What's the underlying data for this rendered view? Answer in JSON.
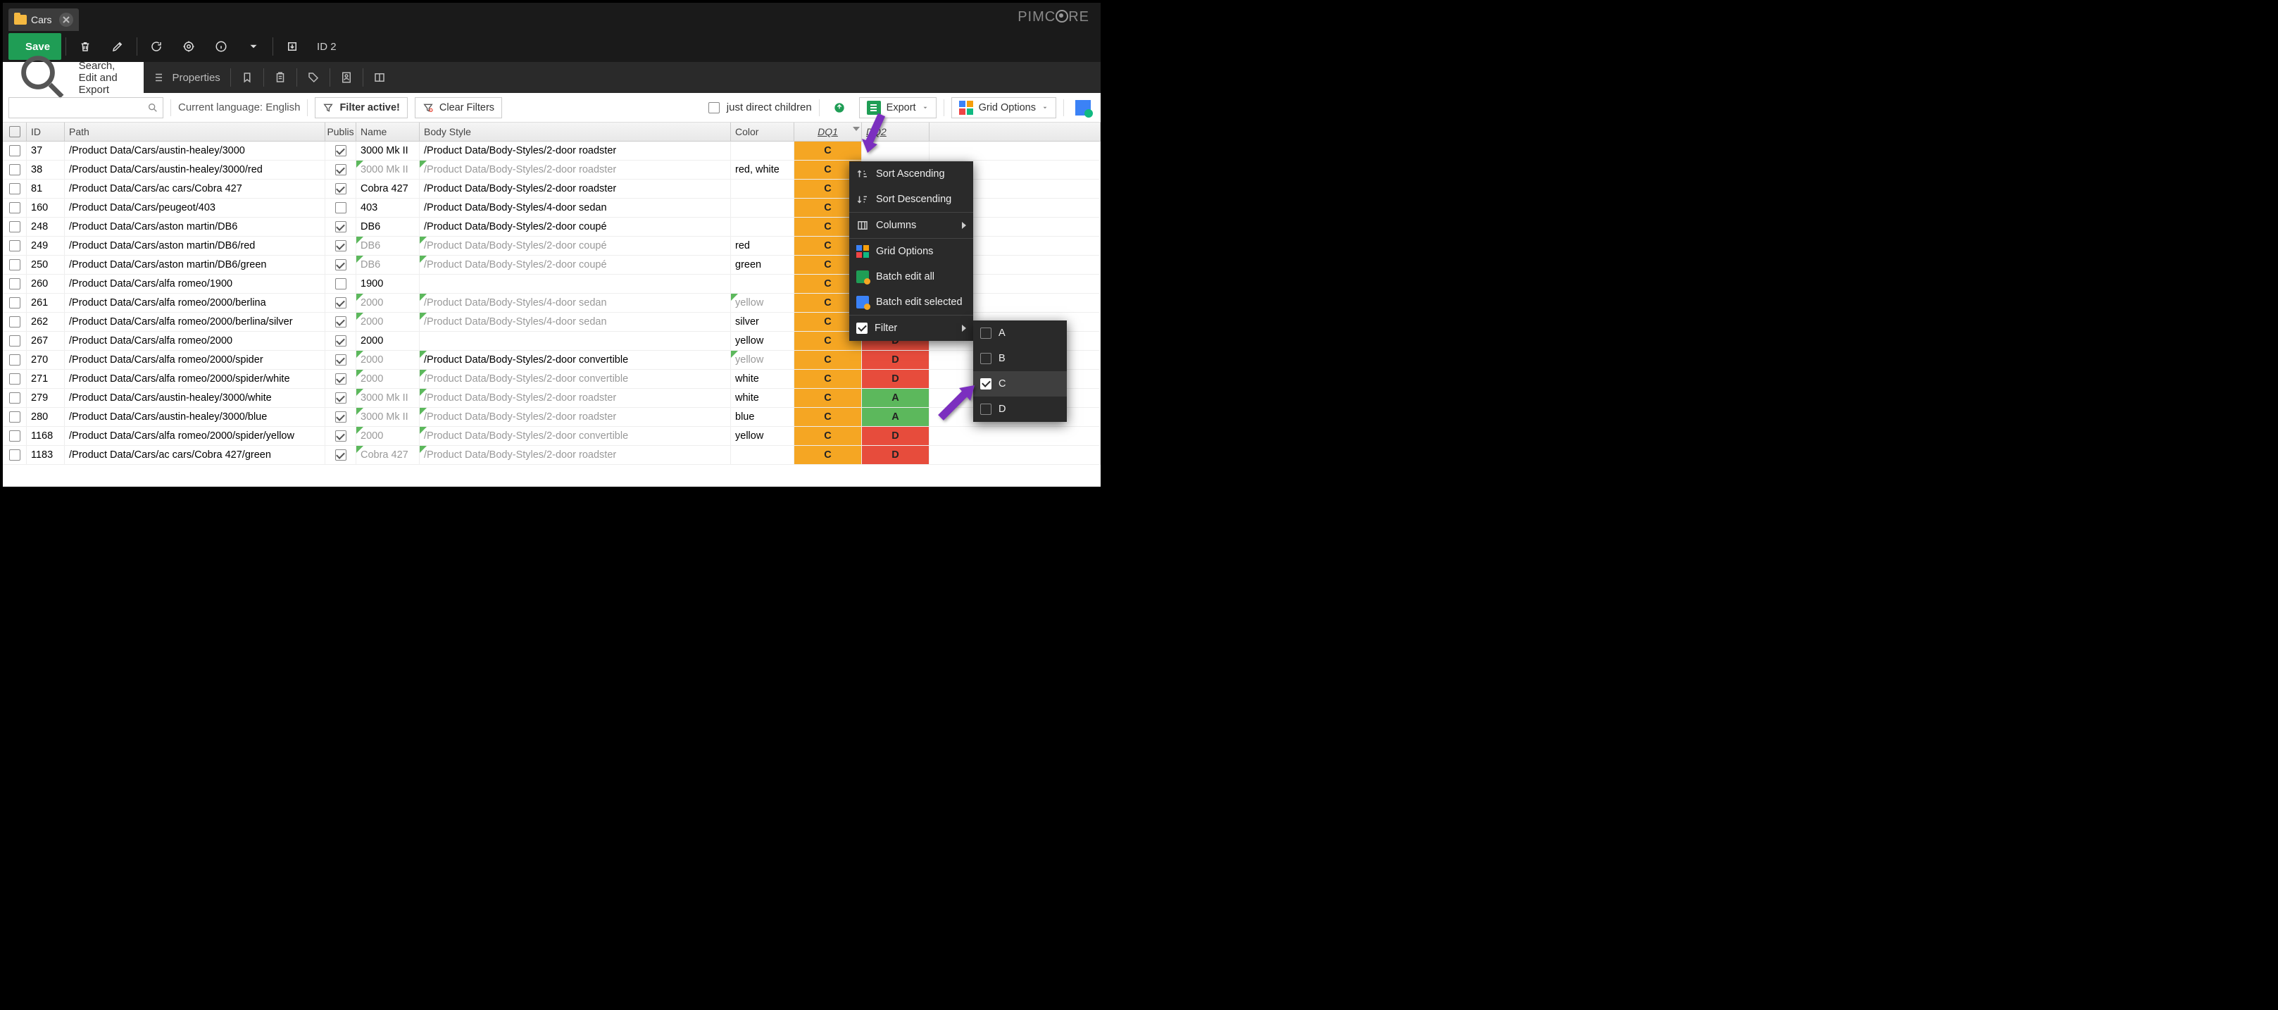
{
  "tab": {
    "title": "Cars"
  },
  "brand": "PIMCORE",
  "toolbar": {
    "save_label": "Save",
    "id_label": "ID 2",
    "search_tab": "Search, Edit and Export",
    "properties": "Properties"
  },
  "filterbar": {
    "language": "Current language: English",
    "filter_active": "Filter active!",
    "clear_filters": "Clear Filters",
    "just_direct": "just direct children",
    "export": "Export",
    "grid_options": "Grid Options"
  },
  "columns": {
    "id": "ID",
    "path": "Path",
    "published": "Publis",
    "name": "Name",
    "body": "Body Style",
    "color": "Color",
    "dq1": "DQ1",
    "dq2": "DQ2"
  },
  "rows": [
    {
      "id": "37",
      "path": "/Product Data/Cars/austin-healey/3000",
      "pub": true,
      "name": "3000 Mk II",
      "body": "/Product Data/Body-Styles/2-door roadster",
      "color": "",
      "dq1": "C",
      "dq2": "",
      "inh": false
    },
    {
      "id": "38",
      "path": "/Product Data/Cars/austin-healey/3000/red",
      "pub": true,
      "name": "3000 Mk II",
      "body": "/Product Data/Body-Styles/2-door roadster",
      "color": "red, white",
      "dq1": "C",
      "dq2": "",
      "inh": true
    },
    {
      "id": "81",
      "path": "/Product Data/Cars/ac cars/Cobra 427",
      "pub": true,
      "name": "Cobra 427",
      "body": "/Product Data/Body-Styles/2-door roadster",
      "color": "",
      "dq1": "C",
      "dq2": "",
      "inh": false
    },
    {
      "id": "160",
      "path": "/Product Data/Cars/peugeot/403",
      "pub": false,
      "name": "403",
      "body": "/Product Data/Body-Styles/4-door sedan",
      "color": "",
      "dq1": "C",
      "dq2": "",
      "inh": false
    },
    {
      "id": "248",
      "path": "/Product Data/Cars/aston martin/DB6",
      "pub": true,
      "name": "DB6",
      "body": "/Product Data/Body-Styles/2-door coupé",
      "color": "",
      "dq1": "C",
      "dq2": "",
      "inh": false
    },
    {
      "id": "249",
      "path": "/Product Data/Cars/aston martin/DB6/red",
      "pub": true,
      "name": "DB6",
      "body": "/Product Data/Body-Styles/2-door coupé",
      "color": "red",
      "dq1": "C",
      "dq2": "",
      "inh": true
    },
    {
      "id": "250",
      "path": "/Product Data/Cars/aston martin/DB6/green",
      "pub": true,
      "name": "DB6",
      "body": "/Product Data/Body-Styles/2-door coupé",
      "color": "green",
      "dq1": "C",
      "dq2": "",
      "inh": true
    },
    {
      "id": "260",
      "path": "/Product Data/Cars/alfa romeo/1900",
      "pub": false,
      "name": "1900",
      "body": "",
      "color": "",
      "dq1": "C",
      "dq2": "",
      "inh": false
    },
    {
      "id": "261",
      "path": "/Product Data/Cars/alfa romeo/2000/berlina",
      "pub": true,
      "name": "2000",
      "body": "/Product Data/Body-Styles/4-door sedan",
      "color": "yellow",
      "dq1": "C",
      "dq2": "",
      "inh": true,
      "colorInh": true
    },
    {
      "id": "262",
      "path": "/Product Data/Cars/alfa romeo/2000/berlina/silver",
      "pub": true,
      "name": "2000",
      "body": "/Product Data/Body-Styles/4-door sedan",
      "color": "silver",
      "dq1": "C",
      "dq2": "",
      "inh": true
    },
    {
      "id": "267",
      "path": "/Product Data/Cars/alfa romeo/2000",
      "pub": true,
      "name": "2000",
      "body": "",
      "color": "yellow",
      "dq1": "C",
      "dq2": "D",
      "inh": false
    },
    {
      "id": "270",
      "path": "/Product Data/Cars/alfa romeo/2000/spider",
      "pub": true,
      "name": "2000",
      "body": "/Product Data/Body-Styles/2-door convertible",
      "color": "yellow",
      "dq1": "C",
      "dq2": "D",
      "inh": true,
      "nameInhOnly": true,
      "colorInh": true
    },
    {
      "id": "271",
      "path": "/Product Data/Cars/alfa romeo/2000/spider/white",
      "pub": true,
      "name": "2000",
      "body": "/Product Data/Body-Styles/2-door convertible",
      "color": "white",
      "dq1": "C",
      "dq2": "D",
      "inh": true
    },
    {
      "id": "279",
      "path": "/Product Data/Cars/austin-healey/3000/white",
      "pub": true,
      "name": "3000 Mk II",
      "body": "/Product Data/Body-Styles/2-door roadster",
      "color": "white",
      "dq1": "C",
      "dq2": "A",
      "inh": true
    },
    {
      "id": "280",
      "path": "/Product Data/Cars/austin-healey/3000/blue",
      "pub": true,
      "name": "3000 Mk II",
      "body": "/Product Data/Body-Styles/2-door roadster",
      "color": "blue",
      "dq1": "C",
      "dq2": "A",
      "inh": true
    },
    {
      "id": "1168",
      "path": "/Product Data/Cars/alfa romeo/2000/spider/yellow",
      "pub": true,
      "name": "2000",
      "body": "/Product Data/Body-Styles/2-door convertible",
      "color": "yellow",
      "dq1": "C",
      "dq2": "D",
      "inh": true
    },
    {
      "id": "1183",
      "path": "/Product Data/Cars/ac cars/Cobra 427/green",
      "pub": true,
      "name": "Cobra 427",
      "body": "/Product Data/Body-Styles/2-door roadster",
      "color": "",
      "dq1": "C",
      "dq2": "D",
      "inh": true
    }
  ],
  "menu": {
    "sort_asc": "Sort Ascending",
    "sort_desc": "Sort Descending",
    "columns": "Columns",
    "grid_options": "Grid Options",
    "batch_all": "Batch edit all",
    "batch_sel": "Batch edit selected",
    "filter": "Filter"
  },
  "filter_options": [
    {
      "label": "A",
      "checked": false
    },
    {
      "label": "B",
      "checked": false
    },
    {
      "label": "C",
      "checked": true
    },
    {
      "label": "D",
      "checked": false
    }
  ]
}
